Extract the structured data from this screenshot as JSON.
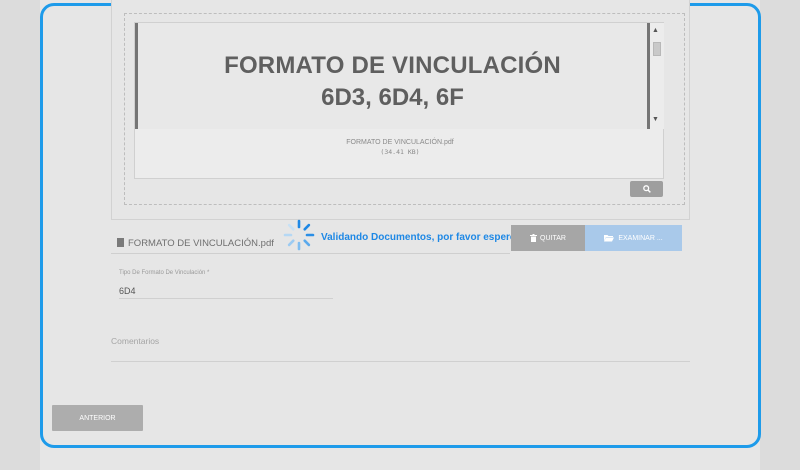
{
  "document_preview": {
    "title_line1": "FORMATO DE VINCULACIÓN",
    "title_line2": "6D3, 6D4, 6F",
    "file_caption": "FORMATO DE VINCULACIÓN.pdf",
    "file_size": "(34.41 KB)",
    "zoom_icon": "search-icon"
  },
  "upload": {
    "file_name": "FORMATO DE VINCULACIÓN.pdf",
    "status_text": "Validando Documentos, por favor espere ...",
    "quitar_label": "QUITAR",
    "examinar_label": "EXAMINAR ...",
    "accent_color": "#1e88e5"
  },
  "form": {
    "tipo_label": "Tipo De Formato De Vinculación *",
    "tipo_value": "6D4",
    "comentarios_label": "Comentarios"
  },
  "footer": {
    "anterior_label": "ANTERIOR"
  }
}
